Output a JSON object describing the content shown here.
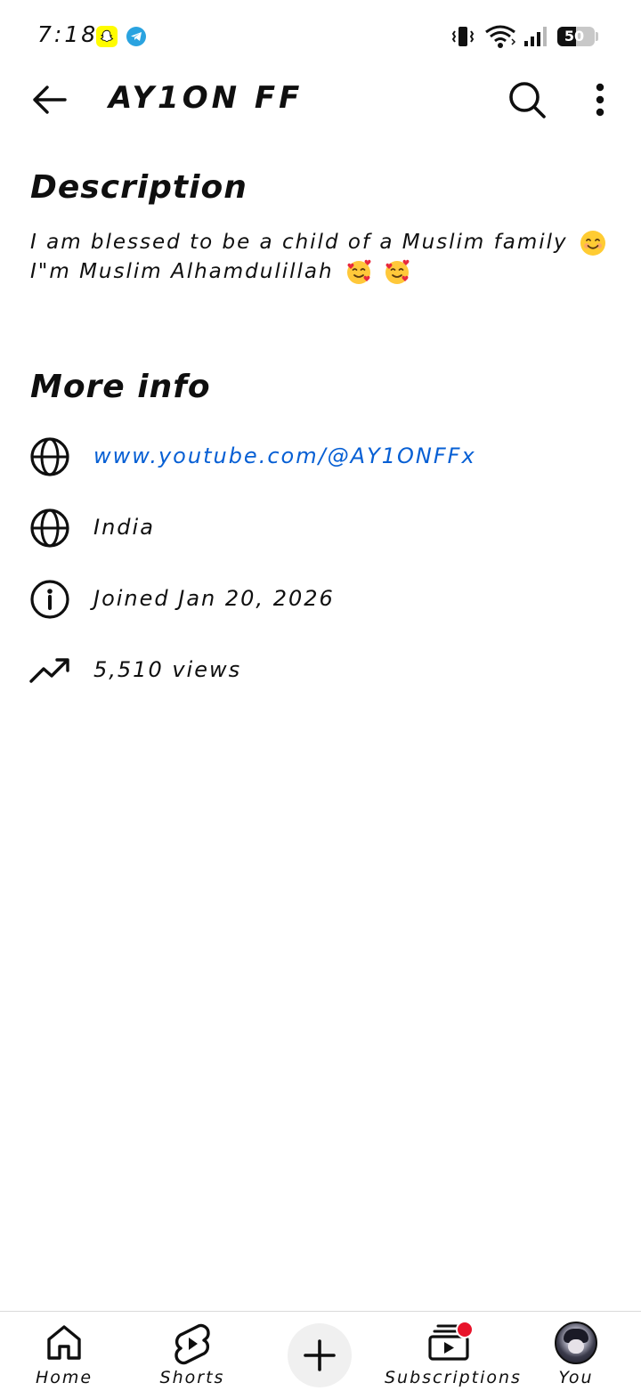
{
  "status_bar": {
    "time": "7:18",
    "battery_level": "50",
    "battery_fraction": 0.5,
    "icons": [
      "snapchat-icon",
      "telegram-icon",
      "vibrate-icon",
      "wifi-icon",
      "signal-icon",
      "battery-icon"
    ]
  },
  "header": {
    "title": "AY1ON FF",
    "icons": [
      "back-arrow-icon",
      "search-icon",
      "more-vert-icon"
    ]
  },
  "description": {
    "heading": "Description",
    "line1": "I am blessed to be a child of a Muslim family",
    "line1_emoji": "smiling-face-icon",
    "line2": "I\"m Muslim Alhamdulillah",
    "line2_emoji": "smiling-face-with-hearts-icon"
  },
  "more_info": {
    "heading": "More info",
    "items": [
      {
        "icon": "globe-icon",
        "text": "www.youtube.com/@AY1ONFFx",
        "is_link": true
      },
      {
        "icon": "globe-icon",
        "text": "India"
      },
      {
        "icon": "info-icon",
        "text": "Joined Jan 20, 2026"
      },
      {
        "icon": "trending-icon",
        "text": "5,510 views"
      }
    ]
  },
  "bottom_nav": {
    "home_label": "Home",
    "shorts_label": "Shorts",
    "subscriptions_label": "Subscriptions",
    "you_label": "You",
    "create_icon": "plus-icon"
  },
  "colors": {
    "link": "#065fd4",
    "text": "#0f0f0f",
    "notification": "#e8132a"
  }
}
